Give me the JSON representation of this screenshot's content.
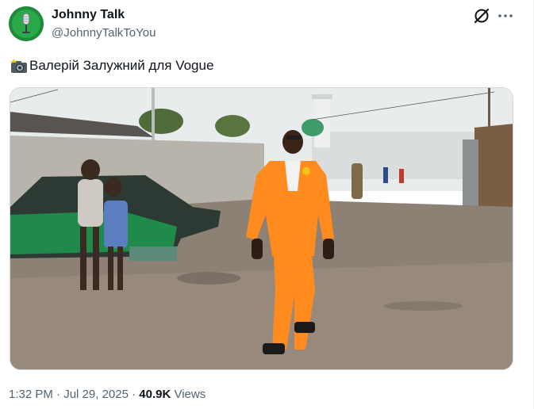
{
  "author": {
    "display_name": "Johnny Talk",
    "handle": "@JohnnyTalkToYou",
    "avatar_icon": "microphone-icon"
  },
  "actions": {
    "grok_icon": "grok-icon",
    "more_icon": "more-icon"
  },
  "tweet": {
    "emoji": "camera-flash-icon",
    "text": "Валерій Залужний для Vogue"
  },
  "media": {
    "type": "photo",
    "subject": "man in orange suit walking on dirt street"
  },
  "meta": {
    "time": "1:32 PM",
    "separator1": " · ",
    "date": "Jul 29, 2025",
    "separator2": " · ",
    "views_count": "40.9K",
    "views_label": " Views"
  },
  "colors": {
    "text_primary": "#0f1419",
    "text_secondary": "#536471",
    "border": "#cfd9de",
    "suit": "#ff8a1e"
  }
}
